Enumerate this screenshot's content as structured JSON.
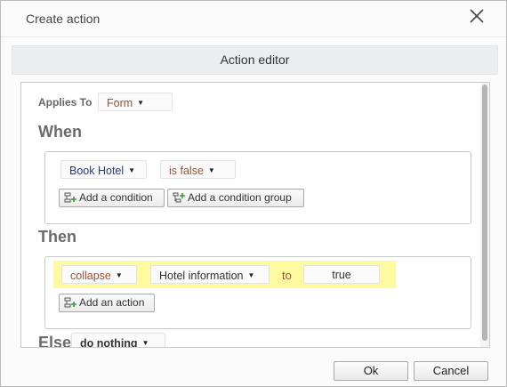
{
  "dialog": {
    "title": "Create action",
    "editor_header": "Action editor",
    "applies_to": {
      "label": "Applies To",
      "value": "Form"
    },
    "when": {
      "heading": "When",
      "condition_field": "Book Hotel",
      "condition_operator": "is false",
      "add_condition_label": "Add a condition",
      "add_condition_group_label": "Add a condition group"
    },
    "then": {
      "heading": "Then",
      "action": "collapse",
      "target": "Hotel information",
      "to_label": "to",
      "value": "true",
      "add_action_label": "Add an action"
    },
    "else": {
      "heading": "Else",
      "value": "do nothing"
    },
    "ok_label": "Ok",
    "cancel_label": "Cancel"
  },
  "icons": {
    "close": "close-icon",
    "add_condition": "add-condition-icon",
    "add_condition_group": "add-condition-group-icon",
    "add_action": "add-action-icon",
    "dropdown": "caret-down-icon"
  },
  "colors": {
    "highlight": "#fffaa0",
    "value_orange": "#a0522d",
    "field_blue": "#1f3a93"
  }
}
